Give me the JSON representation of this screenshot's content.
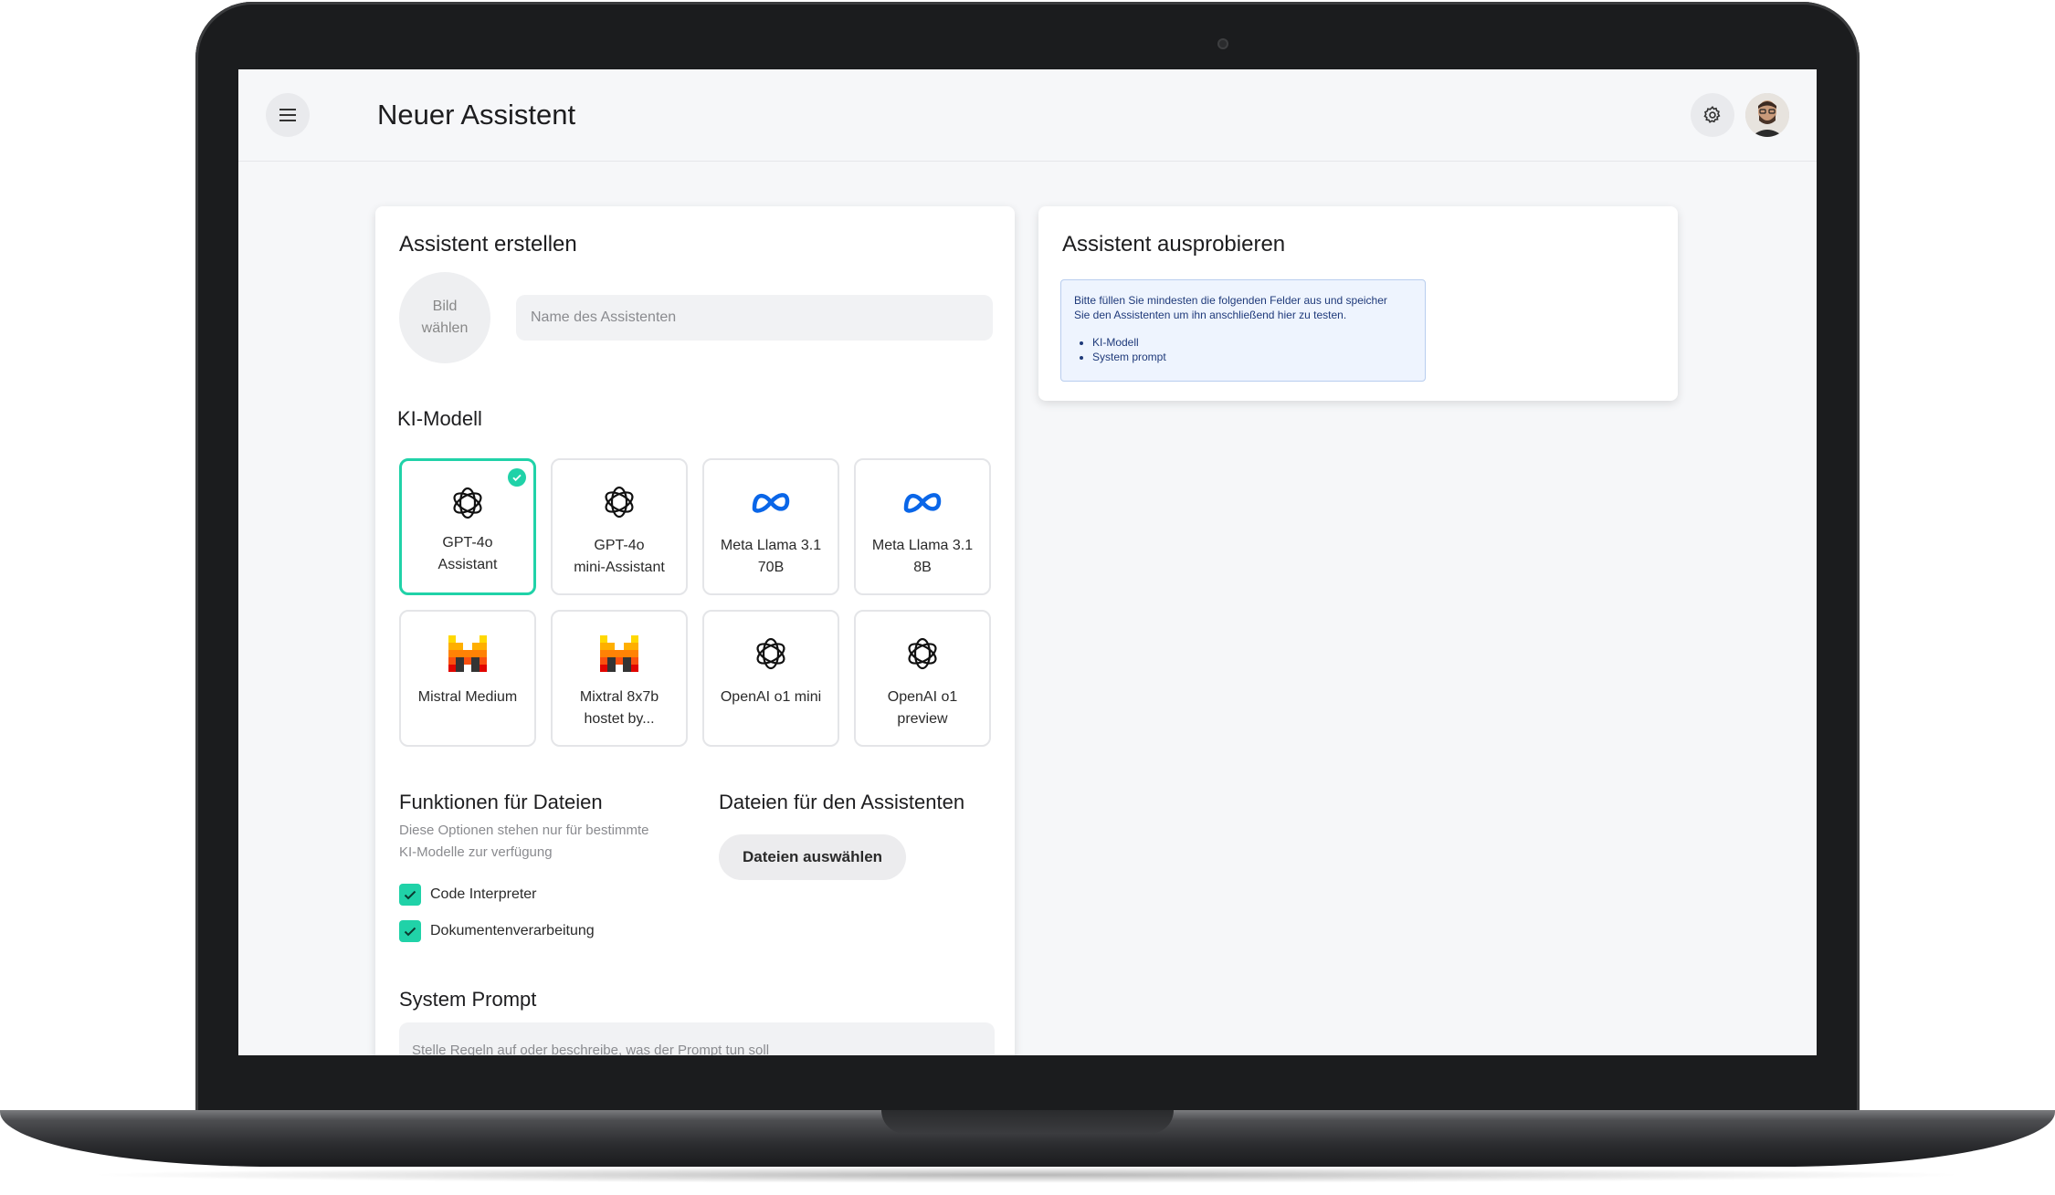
{
  "topbar": {
    "menu_icon": "hamburger-menu-icon",
    "title": "Neuer Assistent",
    "settings_icon": "gear-icon",
    "avatar_icon": "user-avatar"
  },
  "create_card": {
    "title": "Assistent erstellen",
    "image_picker_line1": "Bild",
    "image_picker_line2": "wählen",
    "name_placeholder": "Name des Assistenten",
    "model_section_title": "KI-Modell",
    "models": [
      {
        "line1": "GPT-4o",
        "line2": "Assistant",
        "icon": "openai-icon",
        "selected": true
      },
      {
        "line1": "GPT-4o",
        "line2": "mini-Assistant",
        "icon": "openai-icon",
        "selected": false
      },
      {
        "line1": "Meta Llama 3.1",
        "line2": "70B",
        "icon": "meta-icon",
        "selected": false
      },
      {
        "line1": "Meta Llama 3.1",
        "line2": "8B",
        "icon": "meta-icon",
        "selected": false
      },
      {
        "line1": "Mistral Medium",
        "line2": "",
        "icon": "mistral-icon",
        "selected": false
      },
      {
        "line1": "Mixtral 8x7b",
        "line2": "hostet by...",
        "icon": "mistral-icon",
        "selected": false
      },
      {
        "line1": "OpenAI o1 mini",
        "line2": "",
        "icon": "openai-icon",
        "selected": false
      },
      {
        "line1": "OpenAI o1",
        "line2": "preview",
        "icon": "openai-icon",
        "selected": false
      }
    ],
    "file_functions": {
      "title": "Funktionen für Dateien",
      "desc_line1": "Diese Optionen stehen nur für bestimmte",
      "desc_line2": "KI-Modelle zur verfügung",
      "options": [
        {
          "label": "Code Interpreter",
          "checked": true
        },
        {
          "label": "Dokumentenverarbeitung",
          "checked": true
        }
      ]
    },
    "files": {
      "title": "Dateien für den Assistenten",
      "button_label": "Dateien auswählen"
    },
    "system_prompt": {
      "title": "System Prompt",
      "placeholder": "Stelle Regeln auf oder beschreibe, was der Prompt tun soll"
    }
  },
  "try_card": {
    "title": "Assistent ausprobieren",
    "info_line1": "Bitte füllen Sie mindesten die folgenden Felder aus und speicher",
    "info_line2": "Sie den Assistenten um ihn anschließend hier zu testen.",
    "required_fields": [
      "KI-Modell",
      "System prompt"
    ]
  },
  "colors": {
    "accent": "#20d2a8",
    "meta_blue": "#0a66e8",
    "info_bg": "#eef4fe",
    "info_border": "#b8cdee"
  }
}
